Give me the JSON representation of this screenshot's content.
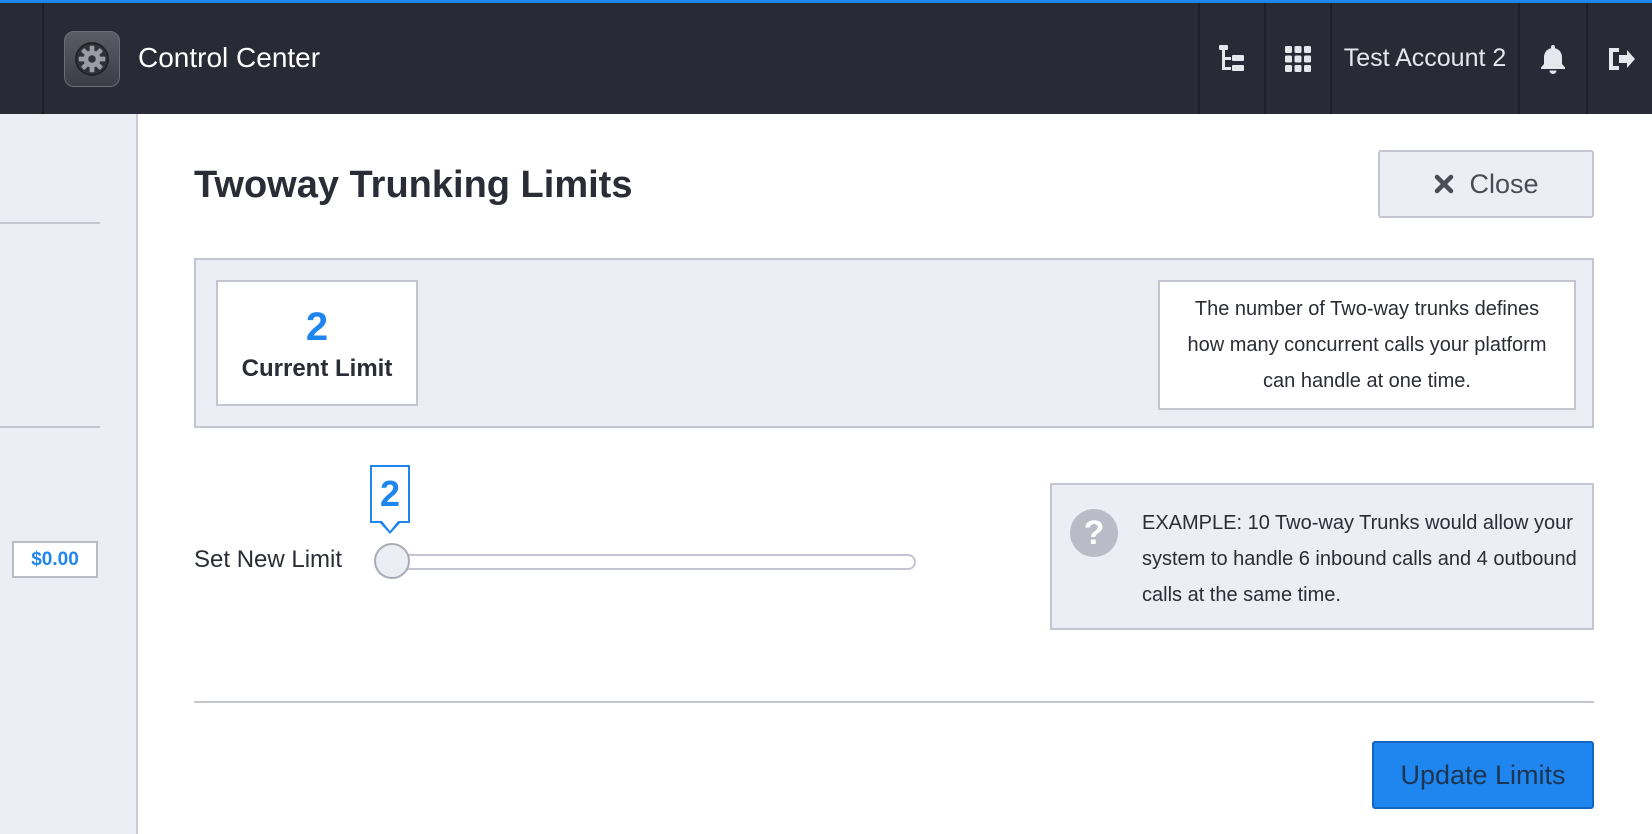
{
  "header": {
    "app_title": "Control Center",
    "app_icon": "gear-icon",
    "account_name": "Test Account 2",
    "nav_icons": [
      "org-chart-icon",
      "apps-grid-icon",
      "bell-icon",
      "logout-icon"
    ]
  },
  "sidebar": {
    "balance": "$0.00"
  },
  "modal": {
    "title": "Twoway Trunking Limits",
    "close_label": "Close",
    "current_limit_value": "2",
    "current_limit_label": "Current Limit",
    "description": "The number of Two-way trunks defines how many concurrent calls your platform can handle at one time.",
    "set_new_limit_label": "Set New Limit",
    "slider": {
      "value_label": "2",
      "fraction": 0.0
    },
    "example_text": "EXAMPLE: 10 Two-way Trunks would allow your system to handle 6 inbound calls and 4 outbound calls at the same time.",
    "update_button_label": "Update Limits"
  },
  "colors": {
    "accent": "#1f86ef",
    "topbar": "#282a35",
    "panel_bg": "#eceef6",
    "border": "#c3c5d0"
  }
}
